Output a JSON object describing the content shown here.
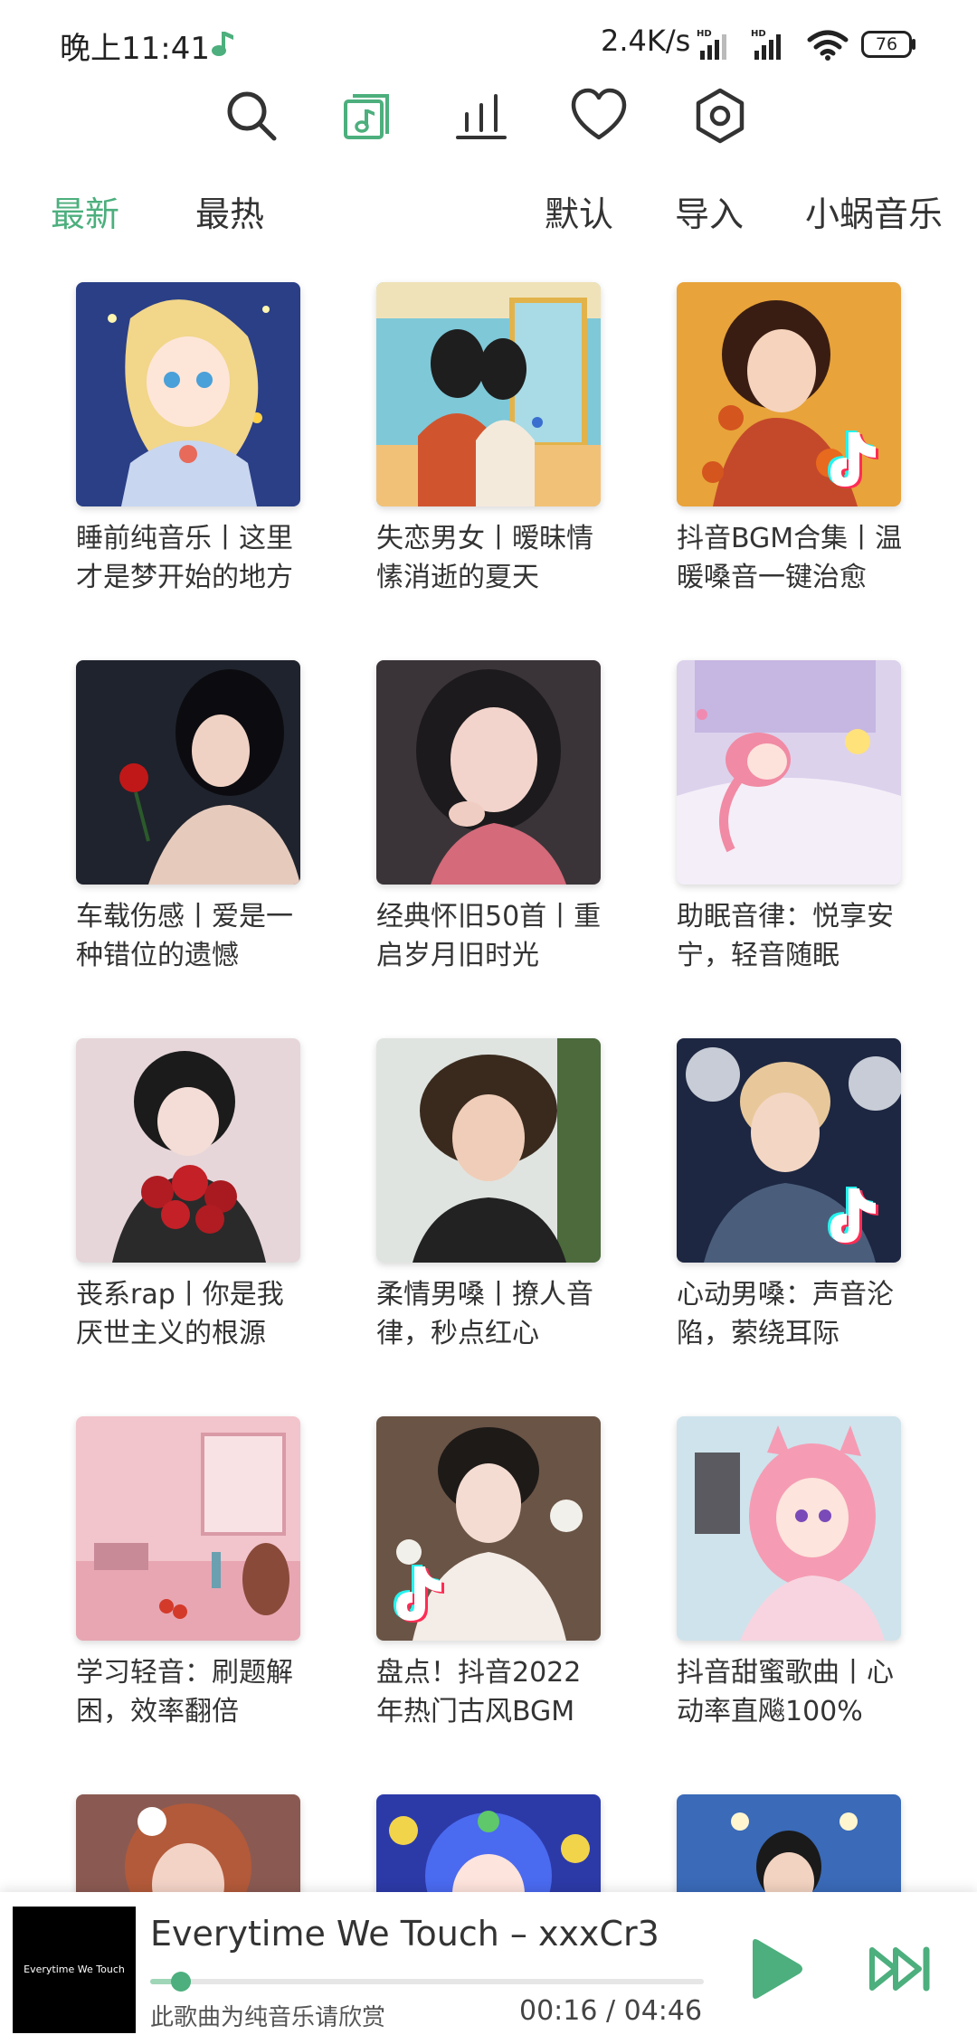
{
  "status_bar": {
    "time": "晚上11:41",
    "net_speed": "2.4K/s",
    "battery": "76",
    "icons": [
      "music-note-icon",
      "hd-signal-icon",
      "hd-signal-icon",
      "wifi-icon",
      "battery-icon"
    ]
  },
  "top_nav": {
    "icons": [
      "search-icon",
      "music-library-icon",
      "chart-icon",
      "heart-icon",
      "settings-icon"
    ],
    "active": "music-library-icon"
  },
  "tabs": {
    "latest": "最新",
    "hot": "最热",
    "default": "默认",
    "import": "导入",
    "source": "小蜗音乐",
    "active": "最新"
  },
  "playlists": [
    {
      "title": "睡前纯音乐丨这里才是梦开始的地方"
    },
    {
      "title": "失恋男女丨暧昧情愫消逝的夏天"
    },
    {
      "title": "抖音BGM合集丨温暖嗓音一键治愈"
    },
    {
      "title": "车载伤感丨爱是一种错位的遗憾"
    },
    {
      "title": "经典怀旧50首丨重启岁月旧时光"
    },
    {
      "title": "助眠音律：悦享安宁，轻音随眠"
    },
    {
      "title": "丧系rap丨你是我厌世主义的根源"
    },
    {
      "title": "柔情男嗓丨撩人音律，秒点红心"
    },
    {
      "title": "心动男嗓：声音沦陷，萦绕耳际"
    },
    {
      "title": "学习轻音：刷题解困，效率翻倍"
    },
    {
      "title": "盘点！抖音2022年热门古风BGM"
    },
    {
      "title": "抖音甜蜜歌曲丨心动率直飚100%"
    }
  ],
  "player": {
    "title": "Everytime We Touch – xxxCr3",
    "art_text": "Everytime We Touch",
    "subtitle": "此歌曲为纯音乐请欣赏",
    "time": "00:16 / 04:46",
    "progress": 0.056,
    "accent": "#4caf7d"
  },
  "colors": {
    "accent": "#4caf7d",
    "text": "#333333"
  }
}
